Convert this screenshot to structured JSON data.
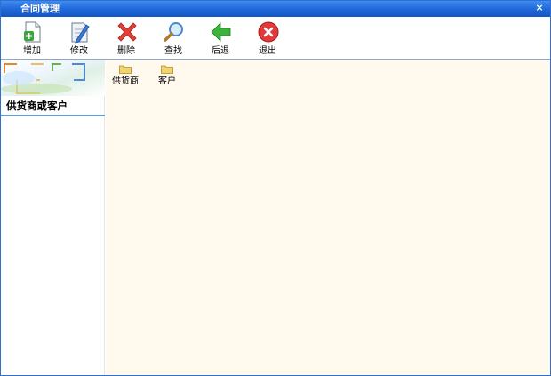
{
  "window": {
    "title": "合同管理",
    "close_glyph": "×"
  },
  "toolbar": {
    "items": [
      {
        "label": "增加",
        "icon": "add-document-icon"
      },
      {
        "label": "修改",
        "icon": "edit-document-icon"
      },
      {
        "label": "删除",
        "icon": "delete-x-icon"
      },
      {
        "label": "查找",
        "icon": "magnifier-icon"
      },
      {
        "label": "后退",
        "icon": "back-arrow-icon"
      },
      {
        "label": "退出",
        "icon": "exit-icon"
      }
    ]
  },
  "sidebar": {
    "title": "供货商或客户"
  },
  "content": {
    "folders": [
      {
        "label": "供货商",
        "icon": "folder-icon"
      },
      {
        "label": "客户",
        "icon": "folder-icon"
      }
    ]
  },
  "colors": {
    "titlebar": "#1f66d6",
    "content_bg": "#fff9ee",
    "accent_line": "#6a9acb"
  }
}
